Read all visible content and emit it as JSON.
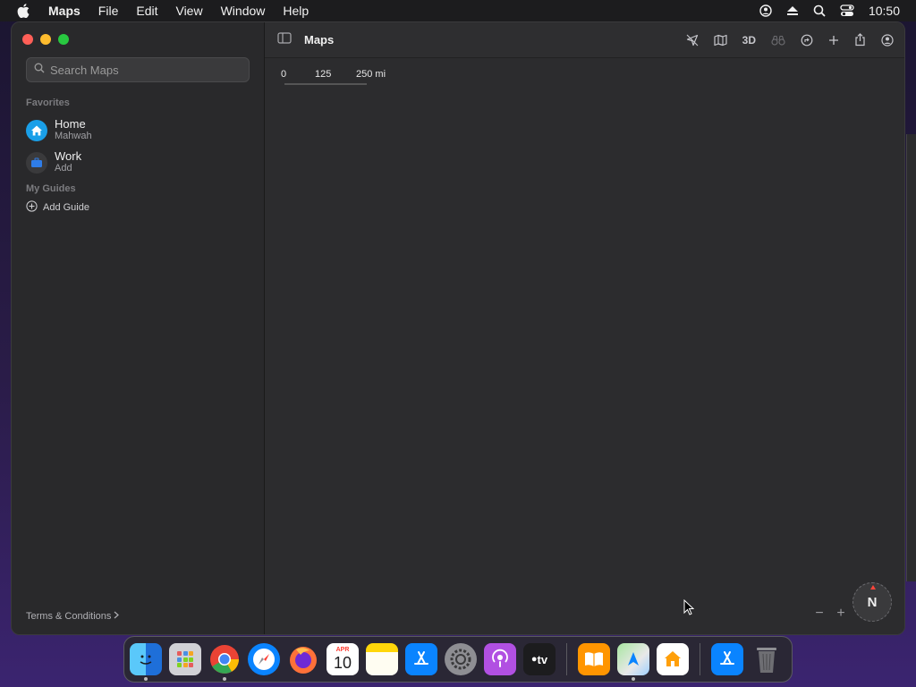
{
  "menubar": {
    "app_name": "Maps",
    "items": [
      "File",
      "Edit",
      "View",
      "Window",
      "Help"
    ],
    "clock": "10:50"
  },
  "sidebar": {
    "search_placeholder": "Search Maps",
    "favorites_title": "Favorites",
    "favorites": [
      {
        "title": "Home",
        "subtitle": "Mahwah",
        "icon": "home-icon",
        "color": "#1a9fe8"
      },
      {
        "title": "Work",
        "subtitle": "Add",
        "icon": "briefcase-icon",
        "color": "#3a3a3c"
      }
    ],
    "guides_title": "My Guides",
    "add_guide_label": "Add Guide",
    "terms_label": "Terms & Conditions"
  },
  "toolbar": {
    "title": "Maps",
    "three_d_label": "3D"
  },
  "map": {
    "scale_labels": [
      "0",
      "125",
      "250 mi"
    ],
    "compass_label": "N"
  },
  "dock": {
    "apps": [
      {
        "name": "Finder",
        "icon": "finder-icon",
        "color": "#1e90ff",
        "running": true
      },
      {
        "name": "Launchpad",
        "icon": "launchpad-icon",
        "color": "#8e8e93",
        "running": false
      },
      {
        "name": "Chrome",
        "icon": "chrome-icon",
        "color": "#34a853",
        "running": true
      },
      {
        "name": "Safari",
        "icon": "safari-icon",
        "color": "#0a84ff",
        "running": false
      },
      {
        "name": "Firefox",
        "icon": "firefox-icon",
        "color": "#ff7139",
        "running": false
      },
      {
        "name": "Calendar",
        "icon": "calendar-icon",
        "color": "#ffffff",
        "running": false,
        "month": "APR",
        "day": "10"
      },
      {
        "name": "Notes",
        "icon": "notes-icon",
        "color": "#ffd60a",
        "running": false
      },
      {
        "name": "App Store",
        "icon": "app-store-icon",
        "color": "#0a84ff",
        "running": false
      },
      {
        "name": "System Preferences",
        "icon": "settings-icon",
        "color": "#636366",
        "running": false
      },
      {
        "name": "Podcasts",
        "icon": "podcasts-icon",
        "color": "#b150e2",
        "running": false
      },
      {
        "name": "Apple TV",
        "icon": "tv-icon",
        "color": "#1c1c1e",
        "running": false,
        "label": "tv"
      },
      {
        "name": "Books",
        "icon": "books-icon",
        "color": "#ff9500",
        "running": false
      },
      {
        "name": "Maps",
        "icon": "maps-icon",
        "color": "#34c759",
        "running": true
      },
      {
        "name": "Home",
        "icon": "home-app-icon",
        "color": "#ff9f0a",
        "running": false
      },
      {
        "name": "App Store Downloads",
        "icon": "app-store-icon",
        "color": "#0a84ff",
        "running": false
      },
      {
        "name": "Trash",
        "icon": "trash-icon",
        "color": "#8e8e93",
        "running": false
      }
    ]
  }
}
